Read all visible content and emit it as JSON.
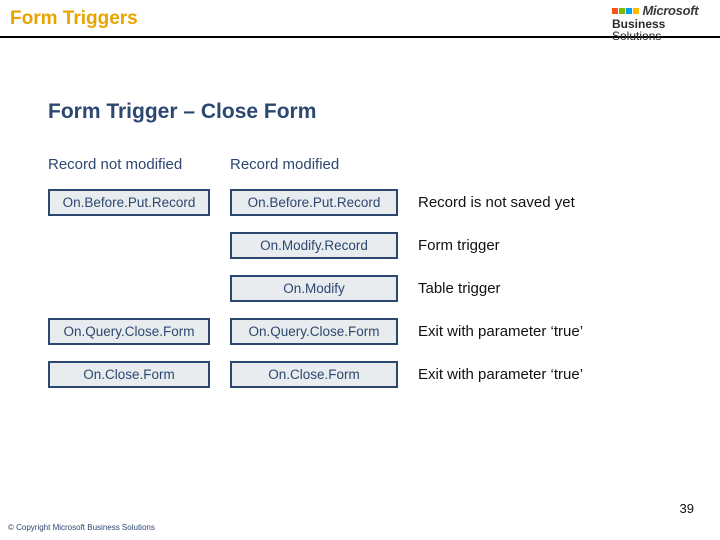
{
  "header": {
    "title": "Form Triggers",
    "logo": {
      "line1": "Microsoft",
      "line2": "Business",
      "line3": "Solutions"
    }
  },
  "subtitle": "Form Trigger – Close Form",
  "columns": {
    "left_head": "Record not modified",
    "mid_head": "Record modified"
  },
  "rows": [
    {
      "left": "On.Before.Put.Record",
      "mid": "On.Before.Put.Record",
      "desc": "Record is not saved yet"
    },
    {
      "left": "",
      "mid": "On.Modify.Record",
      "desc": "Form trigger"
    },
    {
      "left": "",
      "mid": "On.Modify",
      "desc": "Table trigger"
    },
    {
      "left": "On.Query.Close.Form",
      "mid": "On.Query.Close.Form",
      "desc": "Exit with parameter ‘true’"
    },
    {
      "left": "On.Close.Form",
      "mid": "On.Close.Form",
      "desc": "Exit with parameter ‘true’"
    }
  ],
  "page_number": "39",
  "copyright": "© Copyright Microsoft Business Solutions"
}
